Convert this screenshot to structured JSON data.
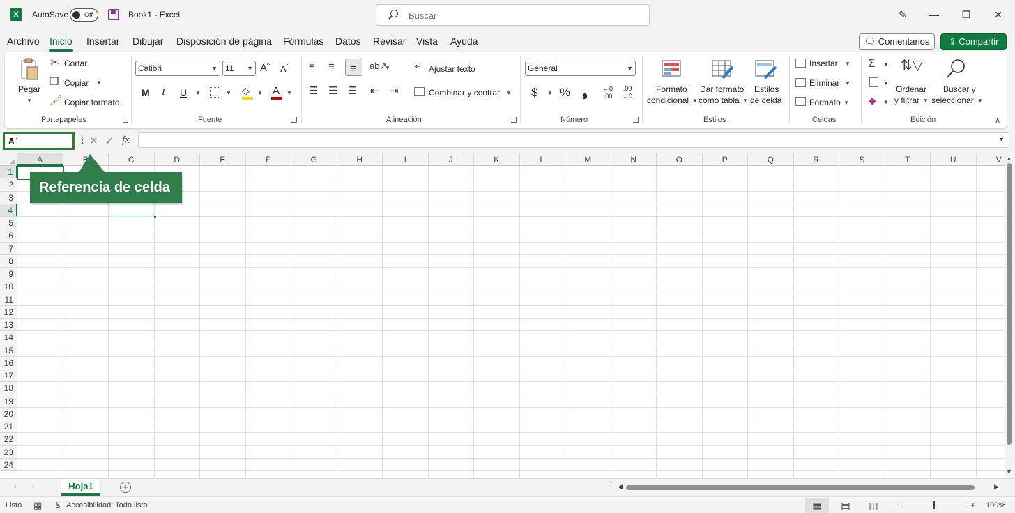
{
  "titlebar": {
    "app_icon_letter": "X",
    "autosave_label": "AutoSave",
    "autosave_state": "Off",
    "doc_title": "Book1  -  Excel",
    "search_placeholder": "Buscar"
  },
  "tabs": [
    "Archivo",
    "Inicio",
    "Insertar",
    "Dibujar",
    "Disposición de página",
    "Fórmulas",
    "Datos",
    "Revisar",
    "Vista",
    "Ayuda"
  ],
  "active_tab": "Inicio",
  "actions": {
    "comments": "Comentarios",
    "share": "Compartir"
  },
  "ribbon": {
    "clipboard": {
      "paste": "Pegar",
      "cut": "Cortar",
      "copy": "Copiar",
      "format_painter": "Copiar formato",
      "label": "Portapapeles"
    },
    "font": {
      "font_name": "Calibri",
      "font_size": "11",
      "bold": "M",
      "italic": "I",
      "underline": "U",
      "label": "Fuente"
    },
    "alignment": {
      "wrap_text": "Ajustar texto",
      "merge_center": "Combinar y centrar",
      "label": "Alineación"
    },
    "number": {
      "format": "General",
      "currency": "$",
      "percent": "%",
      "comma": "❟",
      "inc_decimal": ".00",
      "dec_decimal": ".00",
      "label": "Número"
    },
    "styles": {
      "conditional_1": "Formato",
      "conditional_2": "condicional",
      "table_1": "Dar formato",
      "table_2": "como tabla",
      "cell_1": "Estilos",
      "cell_2": "de celda",
      "label": "Estilos"
    },
    "cells": {
      "insert": "Insertar",
      "delete": "Eliminar",
      "format": "Formato",
      "label": "Celdas"
    },
    "editing": {
      "sort_1": "Ordenar",
      "sort_2": "y filtrar",
      "find_1": "Buscar y",
      "find_2": "seleccionar",
      "label": "Edición"
    }
  },
  "formula_bar": {
    "name_box": "A1",
    "fx": "fx",
    "value": ""
  },
  "grid": {
    "columns": [
      "A",
      "B",
      "C",
      "D",
      "E",
      "F",
      "G",
      "H",
      "I",
      "J",
      "K",
      "L",
      "M",
      "N",
      "O",
      "P",
      "Q",
      "R",
      "S",
      "T",
      "U",
      "V"
    ],
    "rows": [
      "1",
      "2",
      "3",
      "4",
      "5",
      "6",
      "7",
      "8",
      "9",
      "10",
      "11",
      "12",
      "13",
      "14",
      "15",
      "16",
      "17",
      "18",
      "19",
      "20",
      "21",
      "22",
      "23",
      "24"
    ],
    "active_cell": "A1",
    "highlighted_cell": "C4",
    "callout": "Referencia de celda"
  },
  "sheets": {
    "tabs": [
      "Hoja1"
    ],
    "active": "Hoja1"
  },
  "status": {
    "ready": "Listo",
    "accessibility": "Accesibilidad: Todo listo",
    "zoom": "100%",
    "zoom_minus": "−",
    "zoom_plus": "+"
  },
  "colors": {
    "accent": "#107c41",
    "callout": "#2e7d4a"
  }
}
